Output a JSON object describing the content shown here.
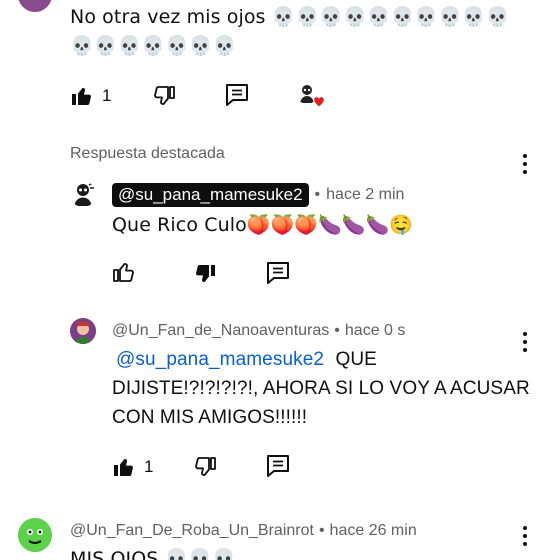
{
  "comment_top": {
    "text": "No otra vez mis ojos 💀💀💀💀💀💀💀💀💀💀",
    "text_line2": "💀💀💀💀💀💀💀",
    "like_count": "1"
  },
  "section_label": "Respuesta destacada",
  "reply_pinned": {
    "author": "@su_pana_mamesuke2",
    "separator": "•",
    "time": "hace 2 min",
    "text": "Que Rico Culo🍑🍑🍑🍆🍆🍆🤤"
  },
  "reply_nano": {
    "author": "@Un_Fan_de_Nanoaventuras",
    "separator": "•",
    "time": "hace 0 s",
    "mention": "@su_pana_mamesuke2",
    "text_after_mention": "QUE",
    "text_line2": "DIJISTE!?!?!?!?!, AHORA SI LO VOY A ACUSAR",
    "text_line3": "CON MIS AMIGOS!!!!!!",
    "like_count": "1"
  },
  "comment_bottom": {
    "author": "@Un_Fan_De_Roba_Un_Brainrot",
    "separator": "•",
    "time": "hace 26 min",
    "text": "MIS OJOS 💀💀💀"
  },
  "colors": {
    "text": "#0f0f0f",
    "meta": "#606060",
    "mention": "#065fd4",
    "chip_bg": "#0f0f0f",
    "heart": "#e02020"
  },
  "icons": [
    "like-icon",
    "dislike-icon",
    "reply-icon",
    "creator-heart-icon",
    "more-options-icon"
  ]
}
